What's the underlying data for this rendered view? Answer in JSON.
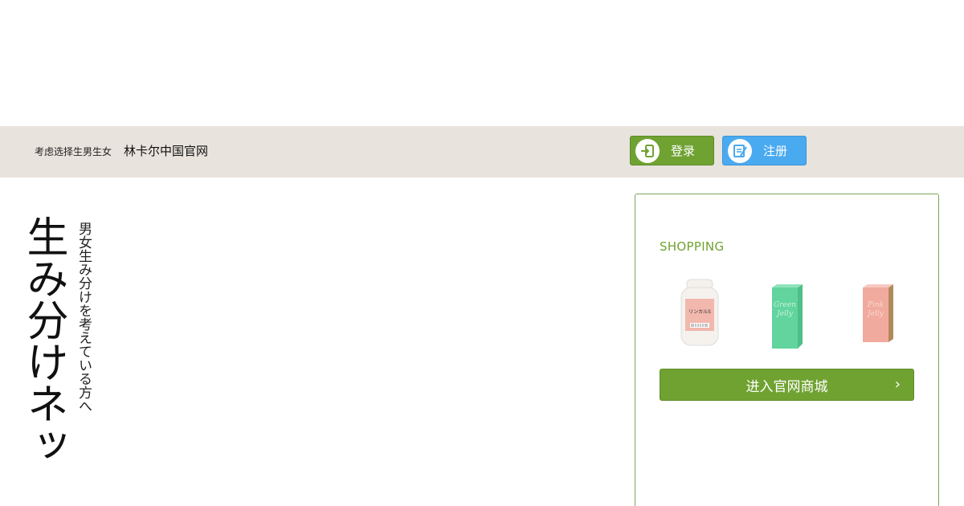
{
  "header": {
    "tagline": "考虑选择生男生女",
    "site_title": "林卡尔中国官网",
    "login_label": "登录",
    "register_label": "注册"
  },
  "hero": {
    "vertical_title": "生み分けネッ",
    "vertical_subtitle": "男女生み分けを考えている方へ"
  },
  "shop": {
    "title": "SHOPPING",
    "products": [
      {
        "name": "リンカルS",
        "kind": "bottle"
      },
      {
        "name": "Green Jelly",
        "kind": "box",
        "color": "#5fd09a"
      },
      {
        "name": "Pink Jelly",
        "kind": "box",
        "color": "#f0a79c"
      }
    ],
    "cta_label": "进入官网商城",
    "cta_chevron": "›"
  },
  "colors": {
    "green": "#70a232",
    "blue": "#4aaaf0",
    "bar": "#e8e3dc"
  }
}
